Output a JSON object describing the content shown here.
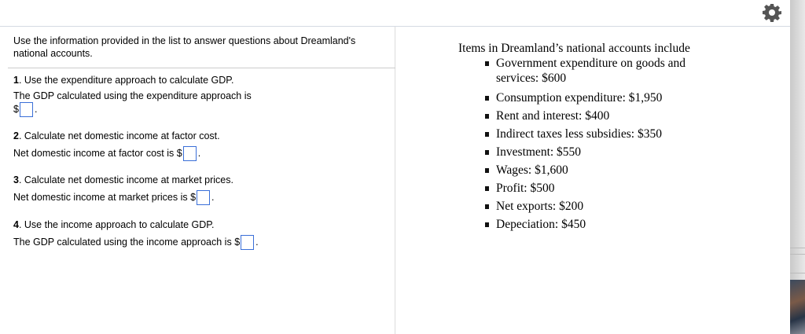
{
  "toolbar": {
    "settings_icon": "gear-icon"
  },
  "intro": "Use the information provided in the list to answer questions about Dreamland's national accounts.",
  "questions": [
    {
      "num": "1",
      "prompt": ". Use the expenditure approach to calculate GDP.",
      "answer_prefix": "The GDP calculated using the expenditure approach is",
      "currency": "$",
      "suffix": ".",
      "value": ""
    },
    {
      "num": "2",
      "prompt": ". Calculate net domestic income at factor cost.",
      "answer_prefix": "Net domestic income at factor cost is",
      "currency": "$",
      "suffix": ".",
      "value": ""
    },
    {
      "num": "3",
      "prompt": ". Calculate net domestic income at market prices.",
      "answer_prefix": "Net domestic income at market prices is",
      "currency": "$",
      "suffix": ".",
      "value": ""
    },
    {
      "num": "4",
      "prompt": ". Use the income approach to calculate GDP.",
      "answer_prefix": "The GDP calculated using the income approach is",
      "currency": "$",
      "suffix": ".",
      "value": ""
    }
  ],
  "info": {
    "title": "Items in Dreamland’s national accounts include",
    "items": [
      "Government expenditure on goods and services: $600",
      "Consumption expenditure: $1,950",
      "Rent and interest: $400",
      "Indirect taxes less subsidies: $350",
      "Investment: $550",
      "Wages: $1,600",
      "Profit: $500",
      "Net exports: $200",
      "Depeciation: $450"
    ]
  }
}
